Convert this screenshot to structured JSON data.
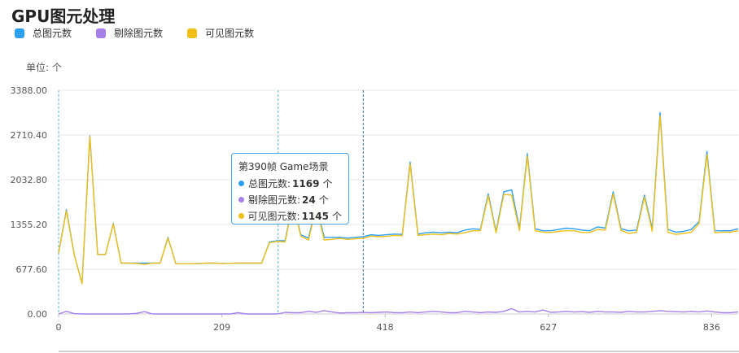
{
  "title": "GPU图元处理",
  "unit_label": "单位: 个",
  "colors": {
    "total": "#2b9ff2",
    "culled": "#a77fe8",
    "visible": "#f0c018",
    "grid": "#e8e8e8",
    "cursor": "#5ab7d6",
    "cursor_dark": "#2f6ea8"
  },
  "legend": [
    {
      "label": "总图元数",
      "color": "#2b9ff2"
    },
    {
      "label": "剔除图元数",
      "color": "#a77fe8"
    },
    {
      "label": "可见图元数",
      "color": "#f0c018"
    }
  ],
  "tooltip": {
    "title": "第390帧 Game场景",
    "rows": [
      {
        "label": "总图元数:",
        "value": "1169",
        "unit": "个",
        "color": "#2b9ff2"
      },
      {
        "label": "剔除图元数:",
        "value": "24",
        "unit": "个",
        "color": "#a77fe8"
      },
      {
        "label": "可见图元数:",
        "value": "1145",
        "unit": "个",
        "color": "#f0c018"
      }
    ]
  },
  "chart_data": {
    "type": "line",
    "ylabel": "单位: 个",
    "ylim": [
      0,
      3388
    ],
    "xlim": [
      0,
      870
    ],
    "yticks": [
      "0.00",
      "677.60",
      "1355.20",
      "2032.80",
      "2710.40",
      "3388.00"
    ],
    "ytick_values": [
      0,
      677.6,
      1355.2,
      2032.8,
      2710.4,
      3388
    ],
    "xticks": [
      "0",
      "209",
      "418",
      "627",
      "836"
    ],
    "xtick_values": [
      0,
      209,
      418,
      627,
      836
    ],
    "markers": [
      0,
      281,
      390
    ],
    "series": [
      {
        "name": "总图元数",
        "x": [
          0,
          10,
          20,
          30,
          40,
          50,
          60,
          70,
          80,
          90,
          100,
          110,
          120,
          130,
          140,
          150,
          160,
          170,
          180,
          190,
          200,
          210,
          220,
          230,
          240,
          250,
          260,
          270,
          280,
          290,
          300,
          310,
          320,
          330,
          340,
          350,
          360,
          370,
          380,
          390,
          400,
          410,
          420,
          430,
          440,
          450,
          460,
          470,
          480,
          490,
          500,
          510,
          520,
          530,
          540,
          550,
          560,
          570,
          580,
          590,
          600,
          610,
          620,
          630,
          640,
          650,
          660,
          670,
          680,
          690,
          700,
          710,
          720,
          730,
          740,
          750,
          760,
          770,
          780,
          790,
          800,
          810,
          820,
          830,
          840,
          850,
          860,
          870
        ],
        "values": [
          920,
          1580,
          900,
          460,
          2700,
          900,
          900,
          1370,
          770,
          770,
          770,
          770,
          770,
          770,
          1160,
          760,
          760,
          760,
          765,
          770,
          770,
          765,
          768,
          770,
          770,
          770,
          770,
          1090,
          1110,
          1110,
          1700,
          1200,
          1150,
          1650,
          1160,
          1160,
          1160,
          1150,
          1160,
          1169,
          1200,
          1190,
          1200,
          1210,
          1205,
          2300,
          1210,
          1230,
          1240,
          1230,
          1240,
          1230,
          1270,
          1290,
          1280,
          1820,
          1250,
          1850,
          1880,
          1290,
          2430,
          1290,
          1260,
          1260,
          1280,
          1300,
          1290,
          1270,
          1260,
          1320,
          1300,
          1850,
          1290,
          1260,
          1270,
          1800,
          1290,
          3050,
          1280,
          1240,
          1250,
          1280,
          1400,
          2460,
          1260,
          1260,
          1260,
          1290
        ]
      },
      {
        "name": "剔除图元数",
        "x": [
          0,
          10,
          20,
          30,
          40,
          50,
          60,
          70,
          80,
          90,
          100,
          110,
          120,
          130,
          140,
          150,
          160,
          170,
          180,
          190,
          200,
          210,
          220,
          230,
          240,
          250,
          260,
          270,
          280,
          290,
          300,
          310,
          320,
          330,
          340,
          350,
          360,
          370,
          380,
          390,
          400,
          410,
          420,
          430,
          440,
          450,
          460,
          470,
          480,
          490,
          500,
          510,
          520,
          530,
          540,
          550,
          560,
          570,
          580,
          590,
          600,
          610,
          620,
          630,
          640,
          650,
          660,
          670,
          680,
          690,
          700,
          710,
          720,
          730,
          740,
          750,
          760,
          770,
          780,
          790,
          800,
          810,
          820,
          830,
          840,
          850,
          860,
          870
        ],
        "values": [
          0,
          40,
          5,
          0,
          0,
          0,
          0,
          0,
          0,
          0,
          10,
          35,
          0,
          0,
          0,
          0,
          0,
          0,
          0,
          0,
          0,
          0,
          0,
          20,
          0,
          0,
          0,
          0,
          0,
          25,
          20,
          20,
          40,
          25,
          50,
          30,
          15,
          20,
          20,
          24,
          20,
          25,
          30,
          20,
          20,
          30,
          20,
          30,
          40,
          30,
          20,
          20,
          40,
          30,
          20,
          30,
          25,
          40,
          80,
          30,
          40,
          30,
          60,
          25,
          30,
          40,
          30,
          35,
          25,
          40,
          30,
          30,
          25,
          40,
          30,
          30,
          40,
          50,
          40,
          35,
          30,
          40,
          30,
          45,
          30,
          20,
          20,
          30
        ]
      },
      {
        "name": "可见图元数",
        "x": [
          0,
          10,
          20,
          30,
          40,
          50,
          60,
          70,
          80,
          90,
          100,
          110,
          120,
          130,
          140,
          150,
          160,
          170,
          180,
          190,
          200,
          210,
          220,
          230,
          240,
          250,
          260,
          270,
          280,
          290,
          300,
          310,
          320,
          330,
          340,
          350,
          360,
          370,
          380,
          390,
          400,
          410,
          420,
          430,
          440,
          450,
          460,
          470,
          480,
          490,
          500,
          510,
          520,
          530,
          540,
          550,
          560,
          570,
          580,
          590,
          600,
          610,
          620,
          630,
          640,
          650,
          660,
          670,
          680,
          690,
          700,
          710,
          720,
          730,
          740,
          750,
          760,
          770,
          780,
          790,
          800,
          810,
          820,
          830,
          840,
          850,
          860,
          870
        ],
        "values": [
          920,
          1560,
          895,
          460,
          2690,
          900,
          900,
          1360,
          770,
          770,
          765,
          750,
          770,
          770,
          1150,
          760,
          760,
          760,
          765,
          770,
          770,
          765,
          768,
          770,
          770,
          770,
          770,
          1080,
          1100,
          1090,
          1680,
          1180,
          1120,
          1625,
          1120,
          1130,
          1145,
          1130,
          1140,
          1145,
          1180,
          1170,
          1175,
          1190,
          1185,
          2270,
          1190,
          1200,
          1210,
          1200,
          1220,
          1210,
          1230,
          1260,
          1260,
          1790,
          1230,
          1810,
          1800,
          1260,
          2390,
          1260,
          1240,
          1235,
          1250,
          1260,
          1260,
          1235,
          1235,
          1280,
          1270,
          1820,
          1265,
          1220,
          1240,
          1770,
          1250,
          3000,
          1240,
          1205,
          1220,
          1240,
          1370,
          2415,
          1230,
          1240,
          1240,
          1260
        ]
      }
    ]
  }
}
